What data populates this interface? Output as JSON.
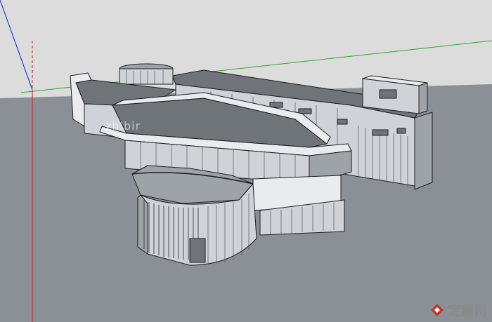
{
  "watermark": {
    "faint_text": "zhibir",
    "brand_text": "定鼎网",
    "brand_color": "#c0392b"
  },
  "scene": {
    "sky_color": "#dcdcdc",
    "ground_color": "#8a9096",
    "model_colors": {
      "wall_light": "#e9ebee",
      "wall_mid": "#cfd2d6",
      "wall_dark": "#9ea3a8",
      "roof": "#6f7479",
      "edge": "#1e1e1e"
    },
    "axes": {
      "red_axis": "#d11a1a",
      "green_axis": "#2fa52f",
      "blue_axis": "#2a3fd8"
    }
  }
}
